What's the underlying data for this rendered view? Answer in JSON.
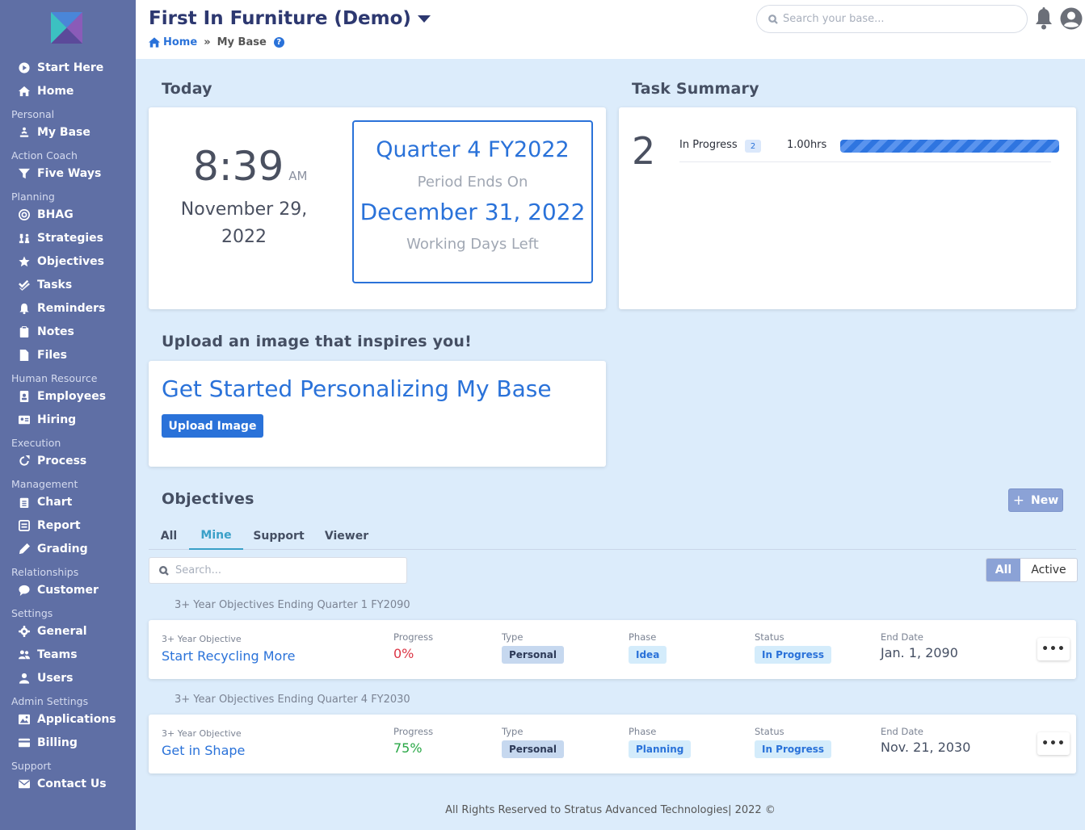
{
  "sidebar": {
    "items": [
      {
        "type": "item",
        "label": "Start Here",
        "icon": "play-circle-icon"
      },
      {
        "type": "item",
        "label": "Home",
        "icon": "home-icon"
      },
      {
        "type": "section",
        "label": "Personal"
      },
      {
        "type": "item",
        "label": "My Base",
        "icon": "meditation-icon"
      },
      {
        "type": "section",
        "label": "Action Coach"
      },
      {
        "type": "item",
        "label": "Five Ways",
        "icon": "funnel-icon"
      },
      {
        "type": "section",
        "label": "Planning"
      },
      {
        "type": "item",
        "label": "BHAG",
        "icon": "target-icon"
      },
      {
        "type": "item",
        "label": "Strategies",
        "icon": "chess-icon"
      },
      {
        "type": "item",
        "label": "Objectives",
        "icon": "star-icon"
      },
      {
        "type": "item",
        "label": "Tasks",
        "icon": "check-double-icon"
      },
      {
        "type": "item",
        "label": "Reminders",
        "icon": "bell-icon"
      },
      {
        "type": "item",
        "label": "Notes",
        "icon": "clipboard-icon"
      },
      {
        "type": "item",
        "label": "Files",
        "icon": "file-icon"
      },
      {
        "type": "section",
        "label": "Human Resource"
      },
      {
        "type": "item",
        "label": "Employees",
        "icon": "id-badge-icon"
      },
      {
        "type": "item",
        "label": "Hiring",
        "icon": "id-card-icon"
      },
      {
        "type": "section",
        "label": "Execution"
      },
      {
        "type": "item",
        "label": "Process",
        "icon": "redo-icon"
      },
      {
        "type": "section",
        "label": "Management"
      },
      {
        "type": "item",
        "label": "Chart",
        "icon": "clipboard-list-icon"
      },
      {
        "type": "item",
        "label": "Report",
        "icon": "report-icon"
      },
      {
        "type": "item",
        "label": "Grading",
        "icon": "pen-icon"
      },
      {
        "type": "section",
        "label": "Relationships"
      },
      {
        "type": "item",
        "label": "Customer",
        "icon": "comment-icon"
      },
      {
        "type": "section",
        "label": "Settings"
      },
      {
        "type": "item",
        "label": "General",
        "icon": "gear-icon"
      },
      {
        "type": "item",
        "label": "Teams",
        "icon": "users-icon"
      },
      {
        "type": "item",
        "label": "Users",
        "icon": "user-icon"
      },
      {
        "type": "section",
        "label": "Admin Settings"
      },
      {
        "type": "item",
        "label": "Applications",
        "icon": "image-icon"
      },
      {
        "type": "item",
        "label": "Billing",
        "icon": "credit-card-icon"
      },
      {
        "type": "section",
        "label": "Support"
      },
      {
        "type": "item",
        "label": "Contact Us",
        "icon": "envelope-icon"
      }
    ]
  },
  "header": {
    "title": "First In Furniture (Demo)",
    "breadcrumb": {
      "home": "Home",
      "separator": "»",
      "current": "My Base",
      "help": "?"
    },
    "search_placeholder": "Search your base..."
  },
  "today": {
    "title": "Today",
    "time": "8:39",
    "ampm": "AM",
    "date": "November 29, 2022",
    "quarter": "Quarter 4 FY2022",
    "period_ends_label": "Period Ends On",
    "period_end_date": "December 31, 2022",
    "working_days_label": "Working Days Left"
  },
  "task_summary": {
    "title": "Task Summary",
    "count": "2",
    "row_label": "In Progress",
    "row_badge": "2",
    "row_hours": "1.00hrs",
    "progress_fraction": 1.0
  },
  "upload": {
    "title": "Upload an image that inspires you!",
    "card_title": "Get Started Personalizing My Base",
    "button": "Upload Image"
  },
  "objectives": {
    "title": "Objectives",
    "new_button": "New",
    "tabs": [
      "All",
      "Mine",
      "Support",
      "Viewer"
    ],
    "active_tab": "Mine",
    "search_placeholder": "Search...",
    "filter": {
      "all": "All",
      "active": "Active"
    },
    "columns": {
      "progress": "Progress",
      "type": "Type",
      "phase": "Phase",
      "status": "Status",
      "end_date": "End Date"
    },
    "more_label": "•••",
    "groups": [
      {
        "label": "3+ Year Objectives Ending Quarter 1 FY2090",
        "items": [
          {
            "kind": "3+ Year Objective",
            "name": "Start Recycling More",
            "progress": "0%",
            "progress_color": "#dc3545",
            "type": "Personal",
            "phase": "Idea",
            "status": "In Progress",
            "end_date": "Jan. 1, 2090"
          }
        ]
      },
      {
        "label": "3+ Year Objectives Ending Quarter 4 FY2030",
        "items": [
          {
            "kind": "3+ Year Objective",
            "name": "Get in Shape",
            "progress": "75%",
            "progress_color": "#28a745",
            "type": "Personal",
            "phase": "Planning",
            "status": "In Progress",
            "end_date": "Nov. 21, 2030"
          }
        ]
      }
    ]
  },
  "footer": "All Rights Reserved to Stratus Advanced Technologies| 2022 ©",
  "colors": {
    "sidebar": "#5f6fa5",
    "accent": "#2a72d9",
    "background": "#dcecfb"
  }
}
